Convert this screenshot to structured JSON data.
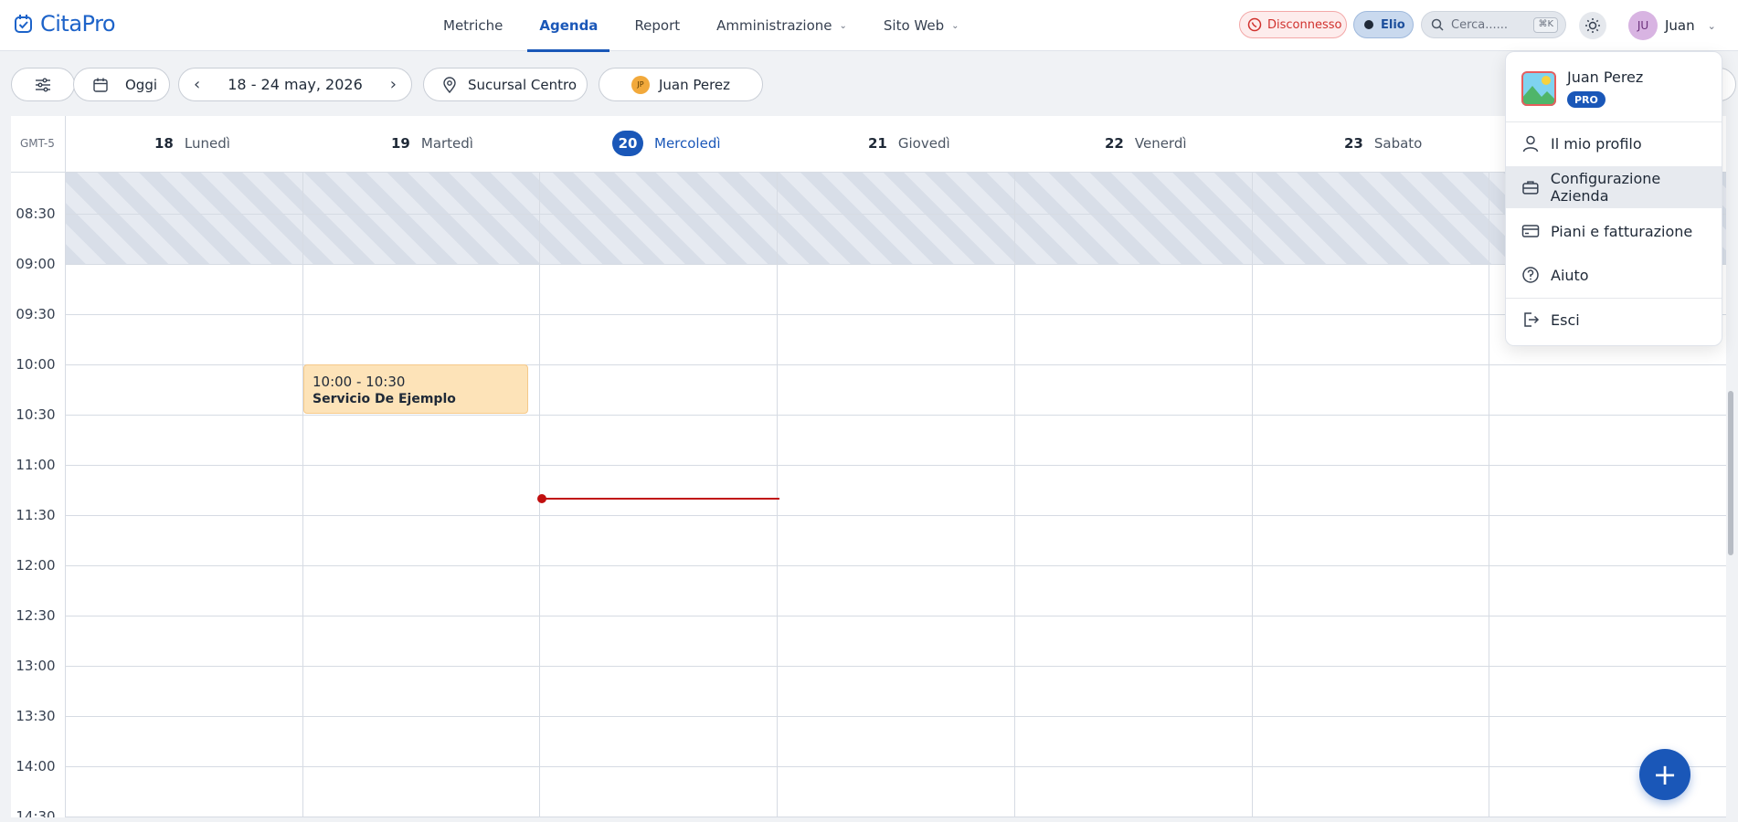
{
  "app": {
    "brand": "CitaPro"
  },
  "nav": {
    "items": [
      {
        "label": "Metriche",
        "active": false
      },
      {
        "label": "Agenda",
        "active": true
      },
      {
        "label": "Report",
        "active": false
      },
      {
        "label": "Amministrazione",
        "active": false,
        "dropdown": true
      },
      {
        "label": "Sito Web",
        "active": false,
        "dropdown": true
      }
    ]
  },
  "header": {
    "whatsapp_status": "Disconnesso",
    "assistant": "Elio",
    "search": {
      "placeholder": "Cerca......",
      "shortcut": "⌘K"
    },
    "user": {
      "initials": "JU",
      "name": "Juan"
    }
  },
  "toolbar": {
    "today_label": "Oggi",
    "date_range": "18 - 24 may, 2026",
    "branch": "Sucursal Centro",
    "staff": {
      "initials": "JP",
      "name": "Juan Perez"
    }
  },
  "calendar": {
    "timezone": "GMT-5",
    "days": [
      {
        "num": "18",
        "name": "Lunedì",
        "today": false
      },
      {
        "num": "19",
        "name": "Martedì",
        "today": false
      },
      {
        "num": "20",
        "name": "Mercoledì",
        "today": true
      },
      {
        "num": "21",
        "name": "Giovedì",
        "today": false
      },
      {
        "num": "22",
        "name": "Venerdì",
        "today": false
      },
      {
        "num": "23",
        "name": "Sabato",
        "today": false
      }
    ],
    "times": [
      "08:30",
      "09:00",
      "09:30",
      "10:00",
      "10:30",
      "11:00",
      "11:30",
      "12:00",
      "12:30",
      "13:00",
      "13:30",
      "14:00",
      "14:30"
    ],
    "events": [
      {
        "time": "10:00 - 10:30",
        "title": "Servicio De Ejemplo",
        "day": "19",
        "color": "#fde3b8"
      }
    ]
  },
  "user_menu": {
    "name": "Juan Perez",
    "badge": "PRO",
    "items": [
      {
        "label": "Il mio profilo",
        "icon": "user-icon"
      },
      {
        "label": "Configurazione Azienda",
        "icon": "briefcase-icon",
        "highlighted": true
      },
      {
        "label": "Piani e fatturazione",
        "icon": "credit-card-icon"
      },
      {
        "label": "Aiuto",
        "icon": "help-circle-icon"
      },
      {
        "label": "Esci",
        "icon": "logout-icon"
      }
    ]
  },
  "fab": {
    "label": "+"
  },
  "colors": {
    "primary": "#1a57b8",
    "now_line": "#c10f0f",
    "event": "#fde3b8"
  }
}
